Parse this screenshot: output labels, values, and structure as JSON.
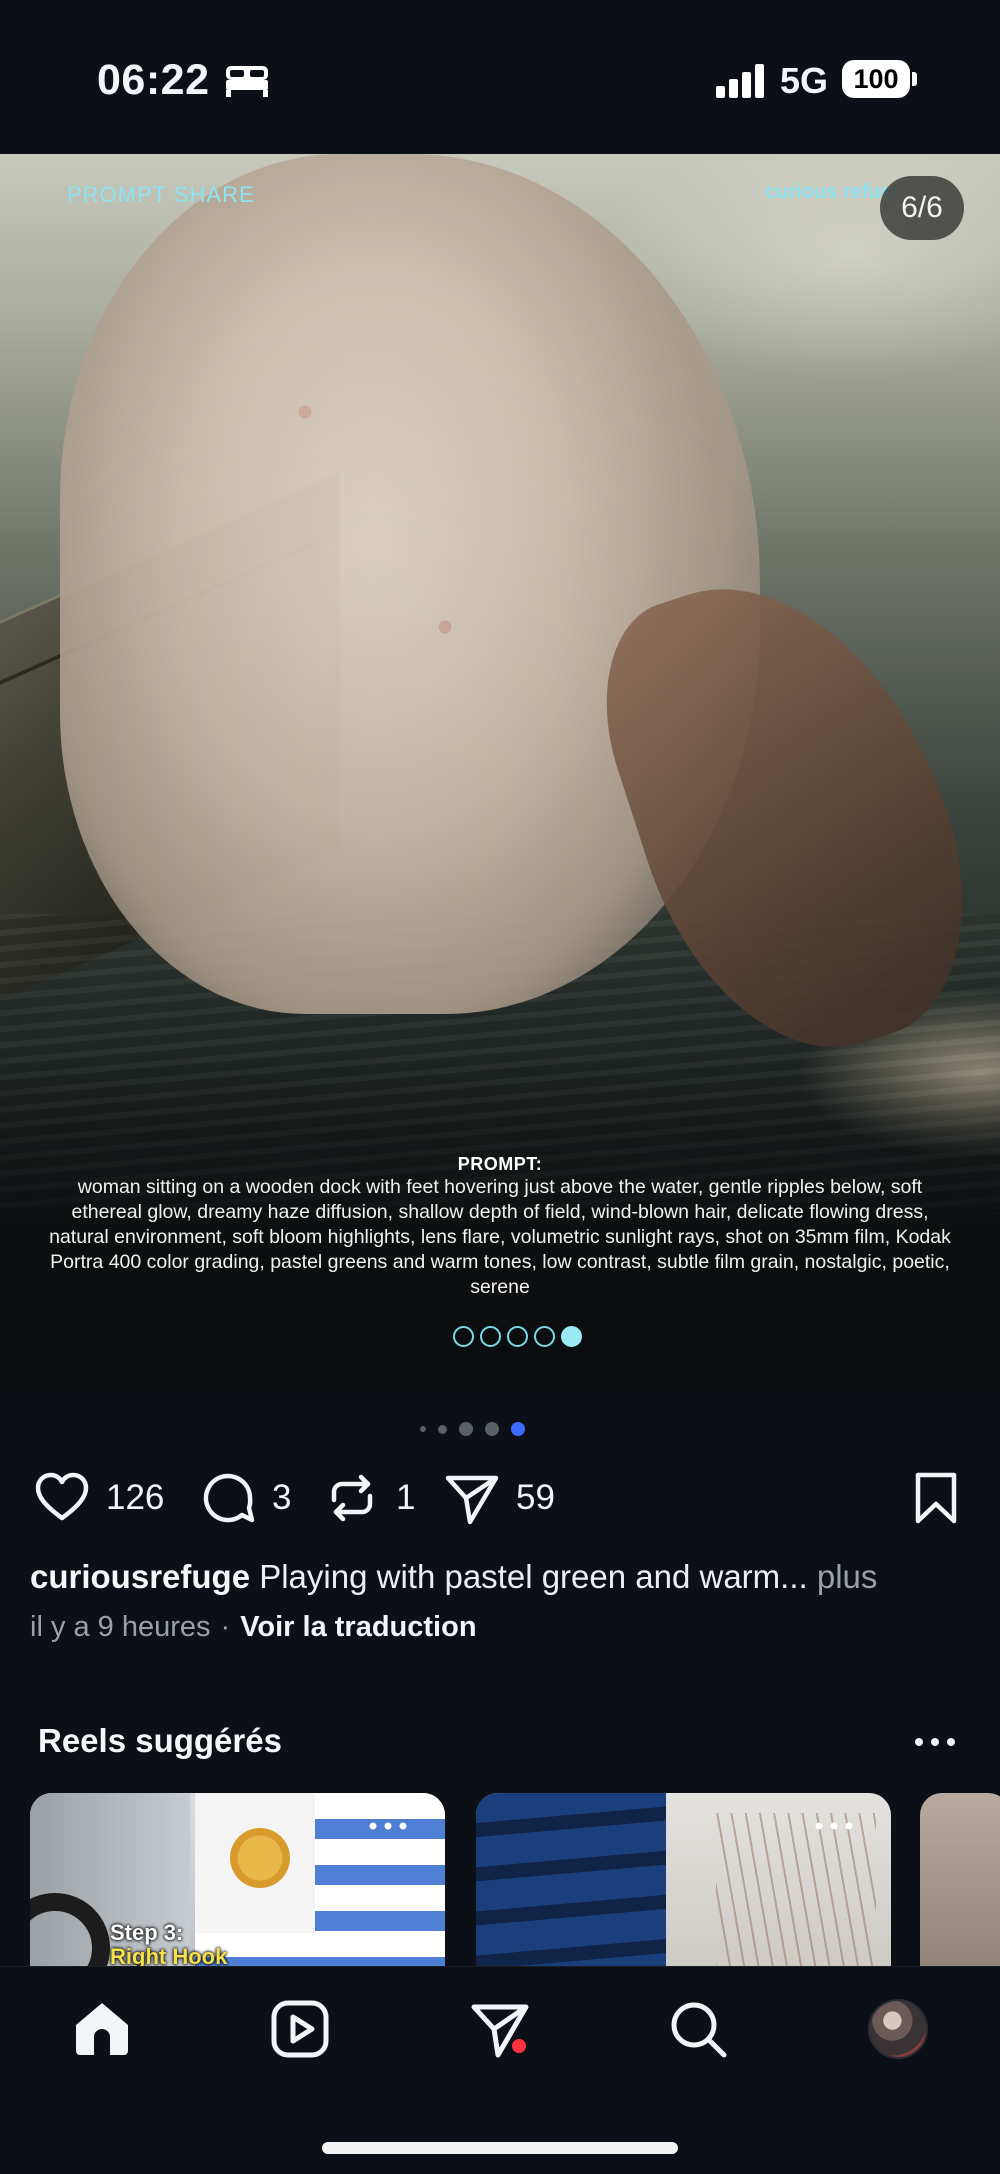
{
  "status_bar": {
    "time": "06:22",
    "network": "5G",
    "battery": "100"
  },
  "post": {
    "media": {
      "brand_left": "PROMPT SHARE",
      "brand_right": "curious refuge",
      "page_counter": "6/6",
      "prompt_title": "PROMPT:",
      "prompt_text": "woman sitting on a wooden dock with feet hovering just above the water, gentle ripples below, soft ethereal glow, dreamy haze diffusion, shallow depth of field, wind-blown hair, delicate flowing dress, natural environment, soft bloom highlights, lens flare, volumetric sunlight rays, shot on 35mm film, Kodak Portra 400 color grading, pastel greens and warm tones, low contrast, subtle film grain, nostalgic, poetic, serene",
      "inner_dots_total": 5,
      "inner_dots_active_index": 4
    },
    "carousel": {
      "total": 6,
      "active_index": 5
    },
    "actions": {
      "likes": "126",
      "comments": "3",
      "reposts": "1",
      "shares": "59"
    },
    "caption": {
      "username": "curiousrefuge",
      "text": "Playing with pastel green and warm...",
      "more": "plus"
    },
    "meta": {
      "time_ago": "il y a 9 heures",
      "separator": "·",
      "translate": "Voir la traduction"
    }
  },
  "suggested_reels": {
    "title": "Reels suggérés",
    "items": [
      {
        "overlay_line1": "Step 3:",
        "overlay_line2": "Right Hook"
      },
      {
        "overlay_line1": "",
        "overlay_line2": ""
      },
      {
        "overlay_line1": "",
        "overlay_line2": ""
      }
    ]
  },
  "colors": {
    "background": "#0c1016",
    "accent_cyan": "#8de3f0",
    "carousel_active": "#3d6bff",
    "notification": "#ff3040"
  },
  "icons": {
    "status": [
      "bed-icon",
      "signal-icon",
      "battery-icon"
    ],
    "actions": [
      "heart-icon",
      "comment-icon",
      "repost-icon",
      "share-icon",
      "bookmark-icon"
    ],
    "nav": [
      "home-icon",
      "reels-icon",
      "direct-messages-icon",
      "search-icon",
      "profile-avatar"
    ]
  }
}
